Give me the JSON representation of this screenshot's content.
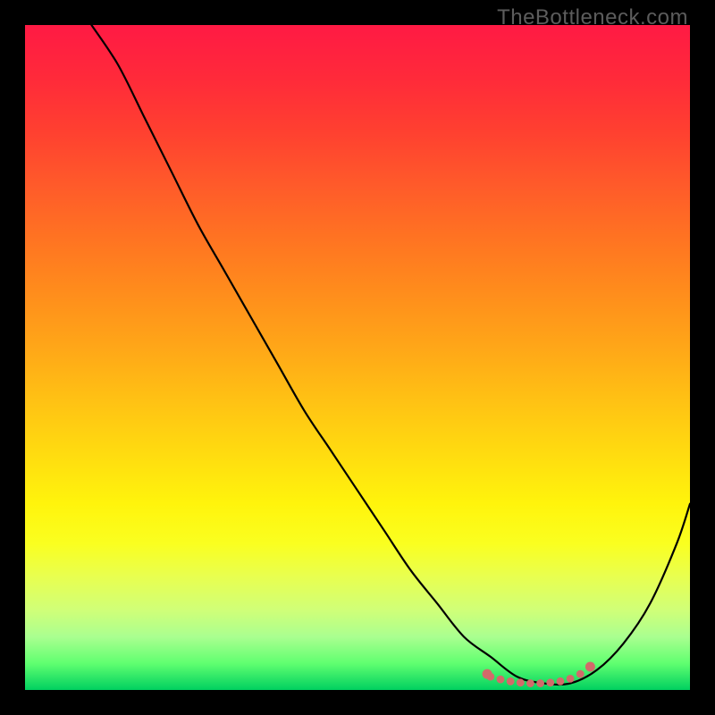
{
  "watermark": "TheBottleneck.com",
  "chart_data": {
    "type": "line",
    "title": "",
    "xlabel": "",
    "ylabel": "",
    "xlim": [
      0,
      100
    ],
    "ylim": [
      0,
      100
    ],
    "series": [
      {
        "name": "curve",
        "x": [
          10,
          14,
          18,
          22,
          26,
          30,
          34,
          38,
          42,
          46,
          50,
          54,
          58,
          62,
          66,
          70,
          74,
          78,
          82,
          86,
          90,
          94,
          98,
          100
        ],
        "y": [
          100,
          94,
          86,
          78,
          70,
          63,
          56,
          49,
          42,
          36,
          30,
          24,
          18,
          13,
          8,
          5,
          2,
          1,
          1,
          3,
          7,
          13,
          22,
          28
        ]
      }
    ],
    "markers": {
      "name": "flat-region-dots",
      "x": [
        69.5,
        70,
        71.5,
        73,
        74.5,
        76,
        77.5,
        79,
        80.5,
        82,
        83.5,
        85
      ],
      "y": [
        2.4,
        2.0,
        1.6,
        1.3,
        1.1,
        1.0,
        1.0,
        1.1,
        1.3,
        1.7,
        2.4,
        3.5
      ]
    },
    "colors": {
      "curve": "#000000",
      "markers": "#d26a6a"
    }
  }
}
